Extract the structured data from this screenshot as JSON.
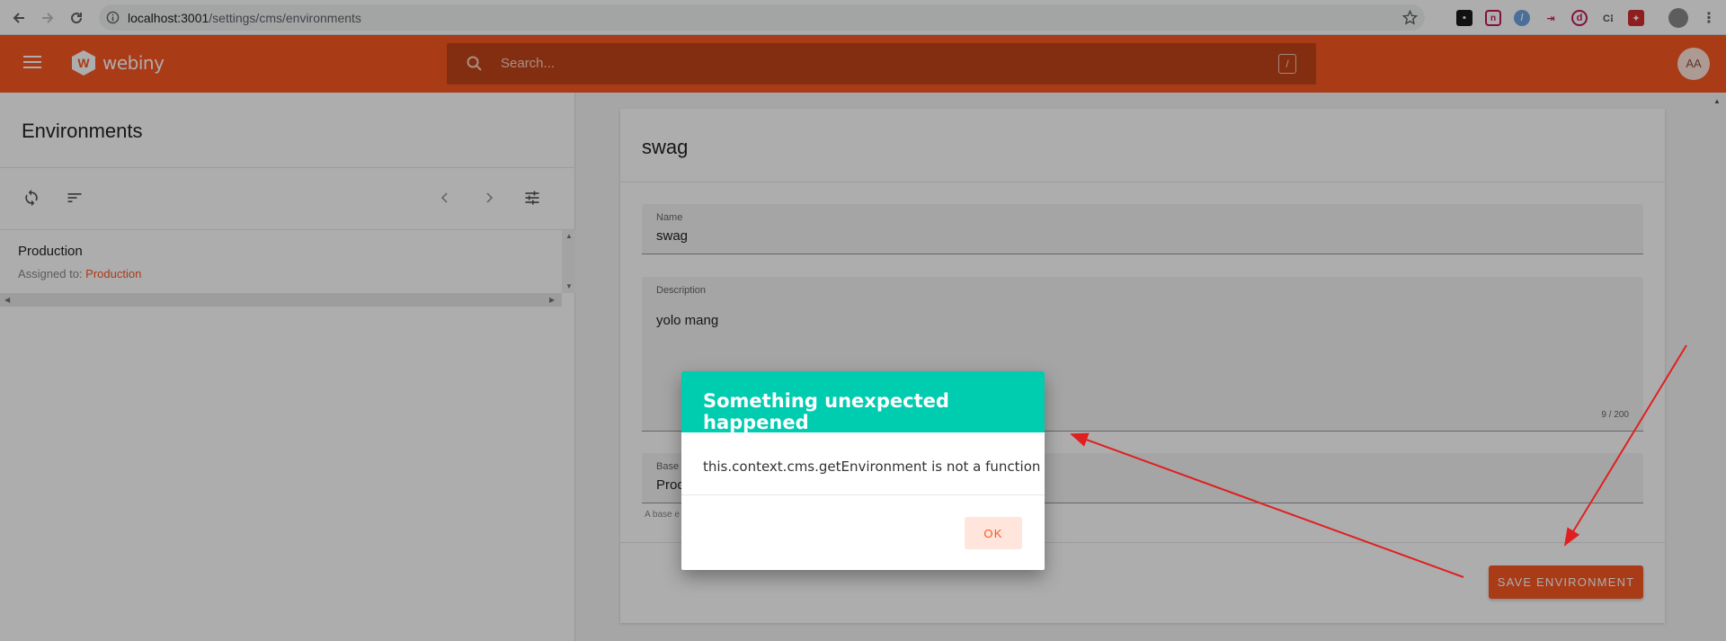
{
  "browser": {
    "url_host": "localhost:3001",
    "url_path": "/settings/cms/environments"
  },
  "header": {
    "logo_text": "webiny",
    "logo_mark": "W",
    "search_placeholder": "Search...",
    "search_shortcut": "/",
    "avatar_initials": "AA"
  },
  "sidebar": {
    "title": "Environments",
    "items": [
      {
        "title": "Production",
        "assigned_label": "Assigned to:",
        "assigned_value": "Production"
      }
    ]
  },
  "form": {
    "title": "swag",
    "name_label": "Name",
    "name_value": "swag",
    "description_label": "Description",
    "description_value": "yolo mang",
    "description_count": "9 / 200",
    "base_label": "Base",
    "base_value": "Proc",
    "base_helper": "A base e",
    "save_label": "SAVE ENVIRONMENT"
  },
  "dialog": {
    "title": "Something unexpected happened",
    "message": "this.context.cms.getEnvironment is not a function",
    "ok_label": "OK"
  },
  "colors": {
    "brand": "#fa5723",
    "dialog_header": "#00ccb0",
    "annotation": "#e02020"
  }
}
